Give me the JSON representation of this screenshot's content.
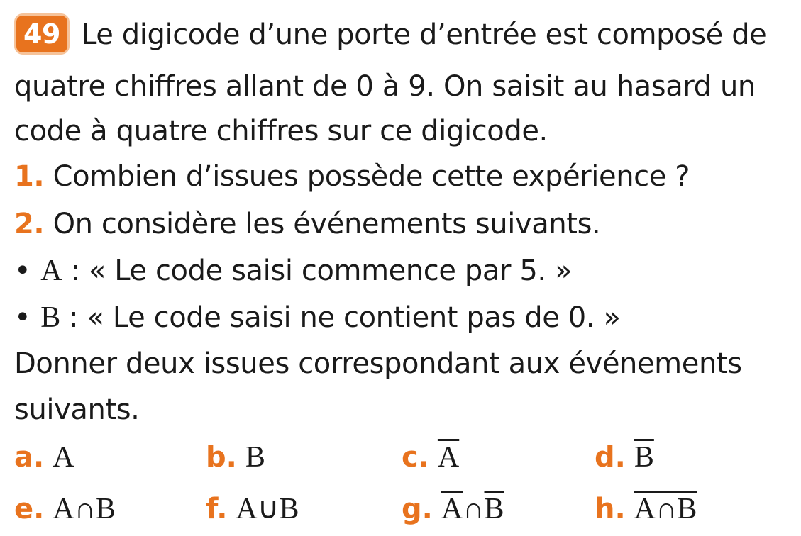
{
  "exercise_number": "49",
  "statement_lines": [
    "Le digicode d’une porte d’entrée est composé de",
    "quatre chiffres allant de 0 à 9. On saisit au hasard un",
    "code à quatre chiffres sur ce digicode."
  ],
  "questions": [
    {
      "number": "1.",
      "text": "Combien d’issues possède cette expérience ?"
    },
    {
      "number": "2.",
      "text": "On considère les événements suivants."
    }
  ],
  "events": [
    {
      "bullet": "•",
      "name": "A",
      "text": " : « Le code saisi commence par 5. »"
    },
    {
      "bullet": "•",
      "name": "B",
      "text": " : « Le code saisi ne contient pas de 0. »"
    }
  ],
  "instruction_lines": [
    "Donner deux issues correspondant aux événements",
    "suivants."
  ],
  "options": {
    "a": {
      "label": "a.",
      "expr": "A"
    },
    "b": {
      "label": "b.",
      "expr": "B"
    },
    "c": {
      "label": "c.",
      "expr": "A"
    },
    "d": {
      "label": "d.",
      "expr": "B"
    },
    "e": {
      "label": "e.",
      "expr": "A∩B"
    },
    "f": {
      "label": "f.",
      "expr": "A∪B"
    },
    "g": {
      "label": "g.",
      "left": "A",
      "op": "∩",
      "right": "B"
    },
    "h": {
      "label": "h.",
      "expr": "A∩B"
    }
  },
  "colors": {
    "accent": "#e8731e",
    "text": "#1a1a1a"
  }
}
